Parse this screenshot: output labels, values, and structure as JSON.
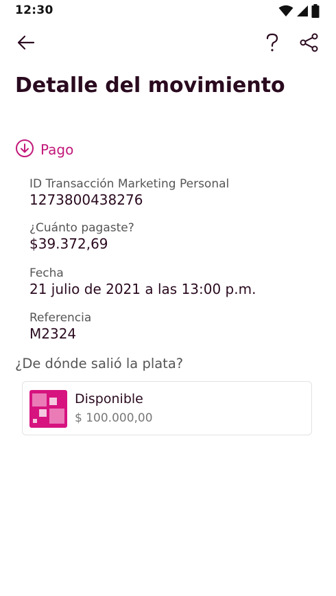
{
  "status_bar": {
    "time": "12:30",
    "icons": [
      "wifi-icon",
      "cell-signal-icon",
      "battery-icon"
    ]
  },
  "app_bar": {
    "back_icon": "arrow-left-icon",
    "help_icon": "question-mark-icon",
    "share_icon": "share-icon"
  },
  "page": {
    "title": "Detalle del movimiento",
    "type_label": "Pago",
    "type_icon": "arrow-down-circle-icon"
  },
  "details": [
    {
      "label": "ID Transacción Marketing Personal",
      "value": "1273800438276"
    },
    {
      "label": "¿Cuánto pagaste?",
      "value": "$39.372,69"
    },
    {
      "label": "Fecha",
      "value": "21 julio de 2021 a las 13:00 p.m."
    },
    {
      "label": "Referencia",
      "value": "M2324"
    }
  ],
  "source": {
    "heading": "¿De dónde salió la plata?",
    "account": {
      "name": "Disponible",
      "balance": "$ 100.000,00",
      "logo_icon": "pink-squares-logo-icon"
    }
  },
  "colors": {
    "accent": "#c2187a",
    "title": "#2a0a1f",
    "label": "#555555",
    "card_border": "#e2e2e2"
  }
}
